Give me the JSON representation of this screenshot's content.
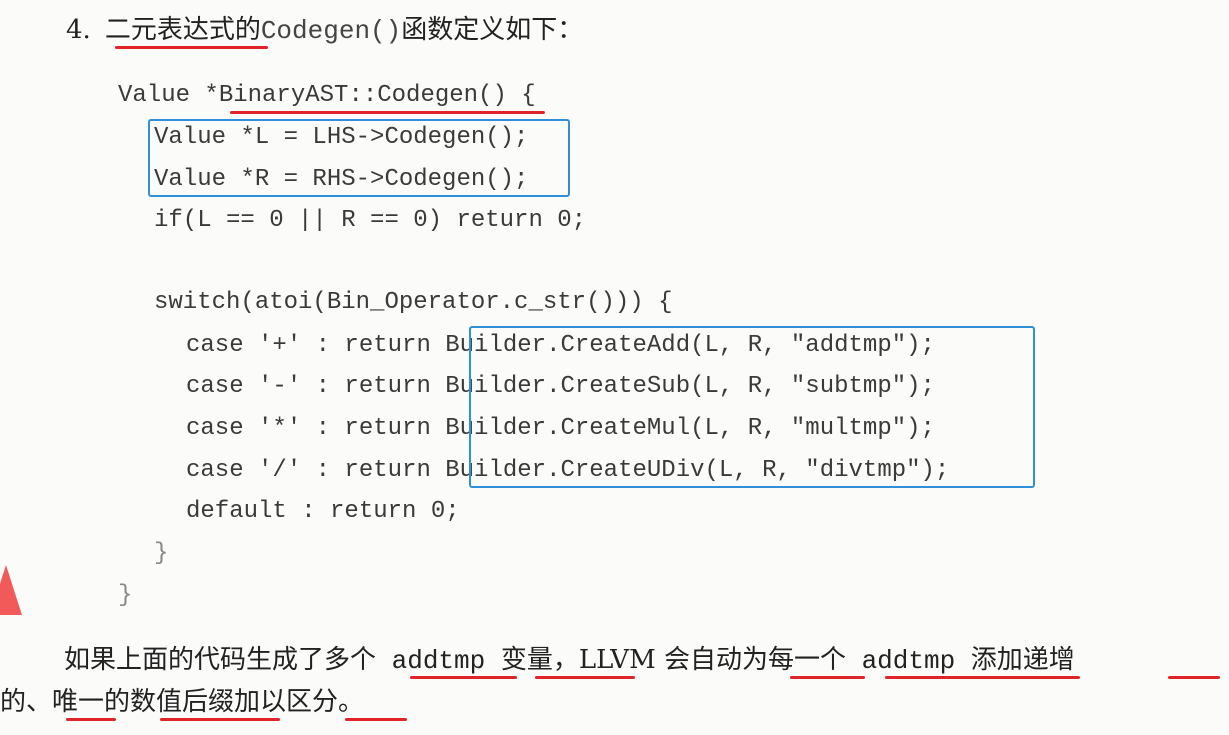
{
  "heading": {
    "number": "4.",
    "prefix": "二元表达式的",
    "code": "Codegen()",
    "suffix": "函数定义如下："
  },
  "code": {
    "line1": "Value *BinaryAST::Codegen() {",
    "line2": "Value *L = LHS->Codegen();",
    "line3": "Value *R = RHS->Codegen();",
    "line4": "if(L == 0 || R == 0) return 0;",
    "line5": "switch(atoi(Bin_Operator.c_str())) {",
    "case1_prefix": "case '+' : return ",
    "case1_call": "Builder.CreateAdd(L, R, \"addtmp\");",
    "case2_prefix": "case '-' : return ",
    "case2_call": "Builder.CreateSub(L, R, \"subtmp\");",
    "case3_prefix": "case '*' : return ",
    "case3_call": "Builder.CreateMul(L, R, \"multmp\");",
    "case4_prefix": "case '/' : return ",
    "case4_call": "Builder.CreateUDiv(L, R, \"divtmp\");",
    "default_line": "default : return 0;",
    "inner_close": "}",
    "outer_close": "}"
  },
  "paragraph": {
    "line1_a": "如果上面的代码生成了多个",
    "line1_code1": " addtmp ",
    "line1_b": "变量，LLVM 会自动为每一个",
    "line1_code2": " addtmp ",
    "line1_c": "添加递增",
    "line2": "的、唯一的数值后缀加以区分。"
  },
  "colors": {
    "underline": "#e0242a",
    "box": "#2f8fd8",
    "arrow": "#f25a5a"
  }
}
